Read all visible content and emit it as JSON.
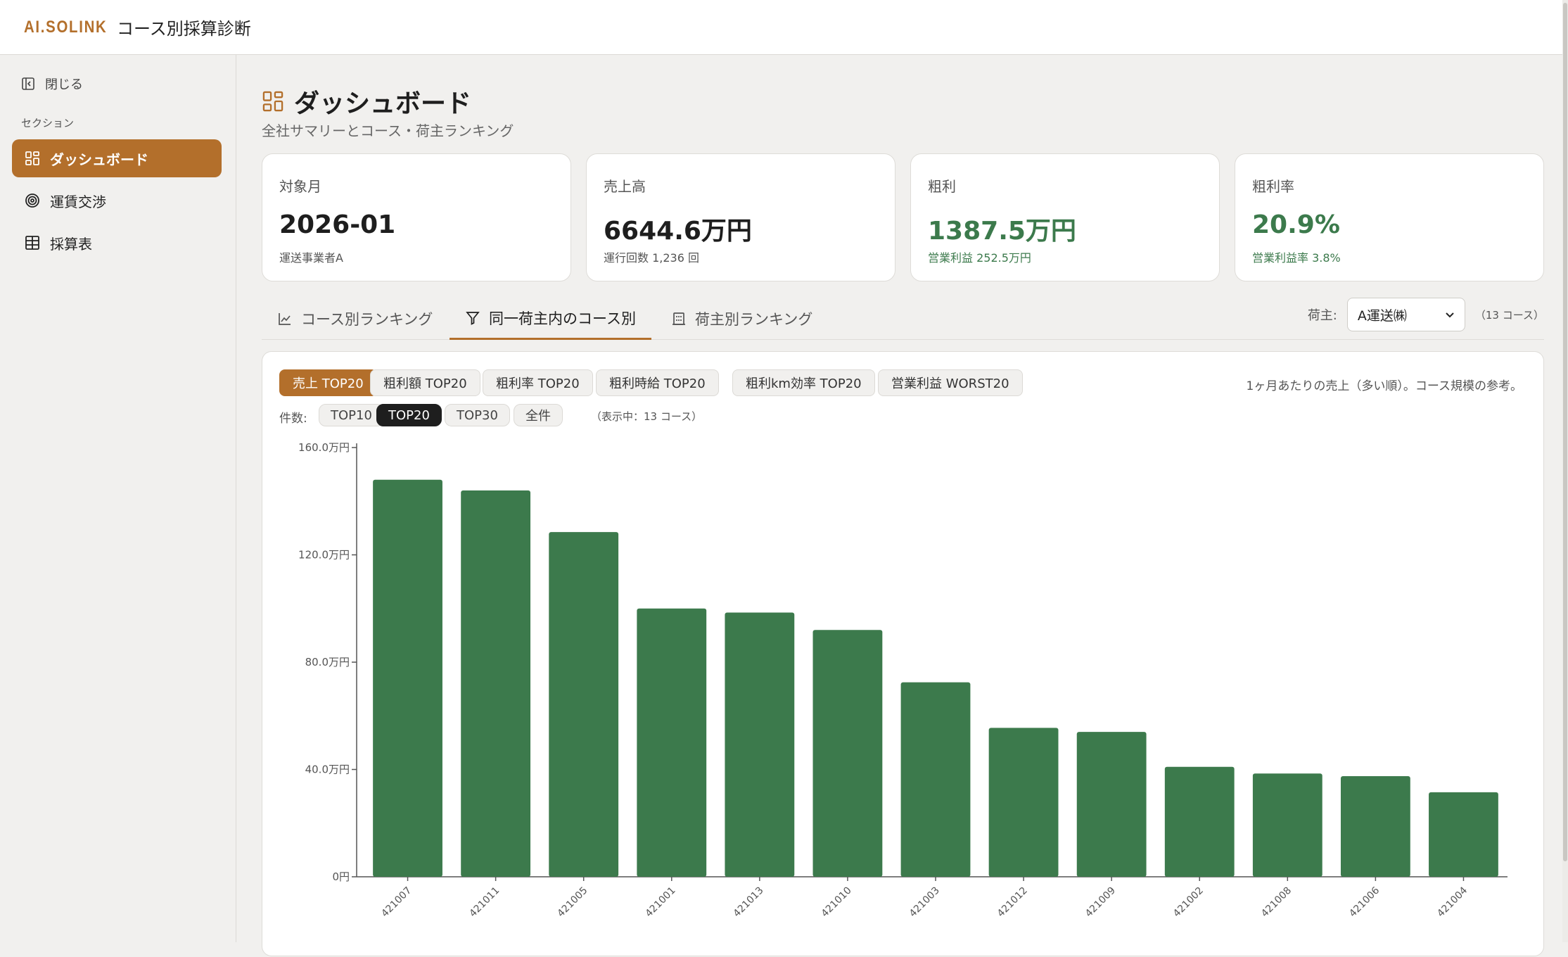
{
  "header": {
    "logo": "AI.SOLINK",
    "title": "コース別採算診断"
  },
  "sidebar": {
    "close_label": "閉じる",
    "section_label": "セクション",
    "items": [
      {
        "label": "ダッシュボード",
        "icon": "dashboard-icon",
        "active": true
      },
      {
        "label": "運賃交渉",
        "icon": "target-icon",
        "active": false
      },
      {
        "label": "採算表",
        "icon": "table-icon",
        "active": false
      }
    ]
  },
  "page": {
    "title": "ダッシュボード",
    "subtitle": "全社サマリーとコース・荷主ランキング"
  },
  "cards": [
    {
      "label": "対象月",
      "value": "2026-01",
      "sub": "運送事業者A"
    },
    {
      "label": "売上高",
      "value": "6644.6万円",
      "sub": "運行回数 1,236 回"
    },
    {
      "label": "粗利",
      "value": "1387.5万円",
      "sub": "営業利益 252.5万円"
    },
    {
      "label": "粗利率",
      "value": "20.9%",
      "sub": "営業利益率 3.8%"
    }
  ],
  "tabs": [
    {
      "label": "コース別ランキング",
      "icon": "chart-line-icon"
    },
    {
      "label": "同一荷主内のコース別",
      "icon": "filter-icon"
    },
    {
      "label": "荷主別ランキング",
      "icon": "building-icon"
    }
  ],
  "shipper": {
    "label": "荷主:",
    "selected": "A運送㈱",
    "count": "（13 コース）"
  },
  "metrics": [
    "売上 TOP20",
    "粗利額 TOP20",
    "粗利率 TOP20",
    "粗利時給 TOP20",
    "粗利km効率 TOP20",
    "営業利益 WORST20"
  ],
  "note": "1ヶ月あたりの売上（多い順）。コース規模の参考。",
  "count_label": "件数:",
  "count_options": [
    "TOP10",
    "TOP20",
    "TOP30",
    "全件"
  ],
  "showing": "（表示中：13 コース）",
  "colors": {
    "accent": "#b36f2b",
    "bar": "#3c7a4c",
    "positive": "#3c7a4c"
  },
  "chart_data": {
    "type": "bar",
    "categories": [
      "421007",
      "421011",
      "421005",
      "421001",
      "421013",
      "421010",
      "421003",
      "421012",
      "421009",
      "421002",
      "421008",
      "421006",
      "421004"
    ],
    "values": [
      148.0,
      144.0,
      128.5,
      100.0,
      98.5,
      92.0,
      72.5,
      55.5,
      54.0,
      41.0,
      38.5,
      37.5,
      31.5
    ],
    "ylim": [
      0,
      160
    ],
    "yticks": [
      "0円",
      "40.0万円",
      "80.0万円",
      "120.0万円",
      "160.0万円"
    ],
    "ytick_values": [
      0,
      40,
      80,
      120,
      160
    ]
  }
}
